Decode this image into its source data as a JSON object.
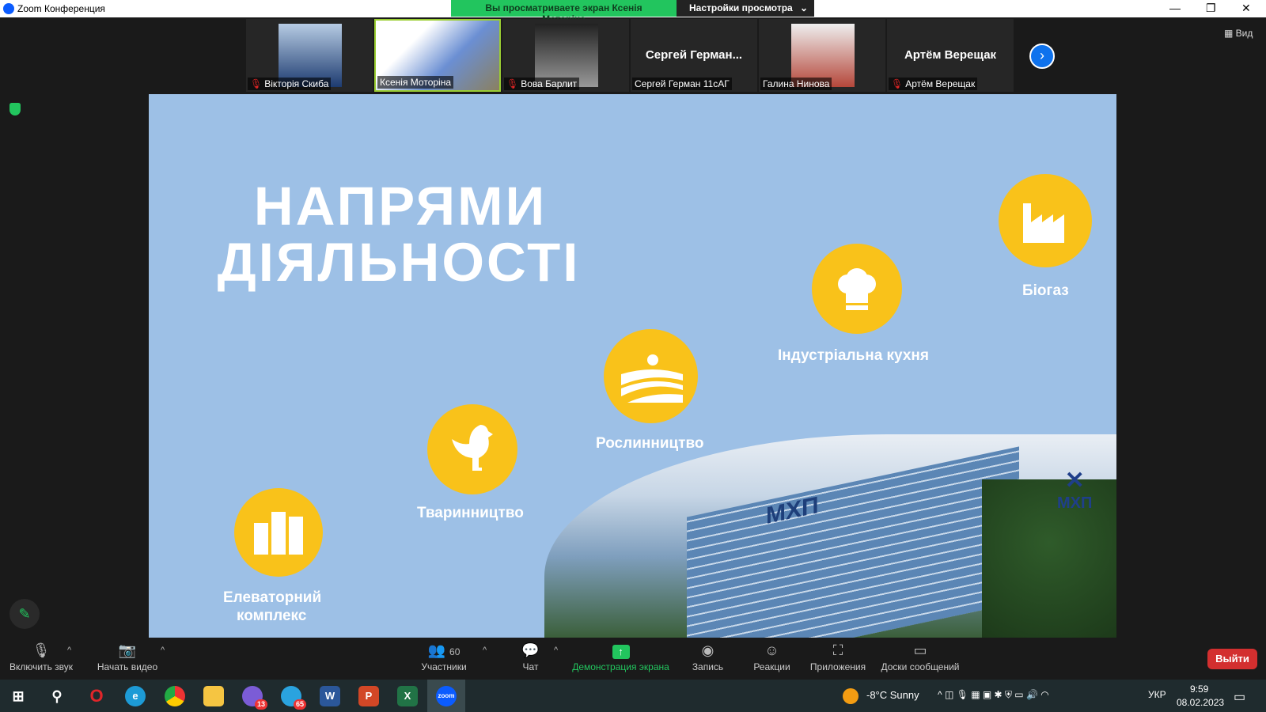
{
  "window": {
    "title": "Zoom Конференция"
  },
  "banner": {
    "viewing": "Вы просматриваете экран Ксенія Моторіна",
    "settings": "Настройки просмотра"
  },
  "participants": [
    {
      "name": "Вікторія Скиба",
      "muted": true
    },
    {
      "name": "Ксенія Моторіна",
      "muted": false
    },
    {
      "name": "Вова Барлит",
      "muted": true
    },
    {
      "name": "Сергей Герман 11сАГ",
      "display": "Сергей  Герман...",
      "muted": false
    },
    {
      "name": "Галина Нинова",
      "muted": false
    },
    {
      "name": "Артём Верещак",
      "display": "Артём Верещак",
      "muted": true
    }
  ],
  "view_label": "Вид",
  "slide": {
    "title_line1": "НАПРЯМИ",
    "title_line2": "ДІЯЛЬНОСТІ",
    "items": [
      "Біогаз",
      "Індустріальна кухня",
      "Рослинництво",
      "Тваринництво",
      "Елеваторний",
      "комплекс"
    ],
    "sign": "МХП",
    "logo": "МХП"
  },
  "toolbar": {
    "audio": "Включить звук",
    "video": "Начать видео",
    "participants": "Участники",
    "participants_count": "60",
    "chat": "Чат",
    "share": "Демонстрация экрана",
    "record": "Запись",
    "reactions": "Реакции",
    "apps": "Приложения",
    "whiteboards": "Доски сообщений",
    "leave": "Выйти"
  },
  "taskbar": {
    "viber_badge": "13",
    "telegram_badge": "65",
    "weather": "-8°C  Sunny",
    "lang": "УКР",
    "time": "9:59",
    "date": "08.02.2023"
  }
}
